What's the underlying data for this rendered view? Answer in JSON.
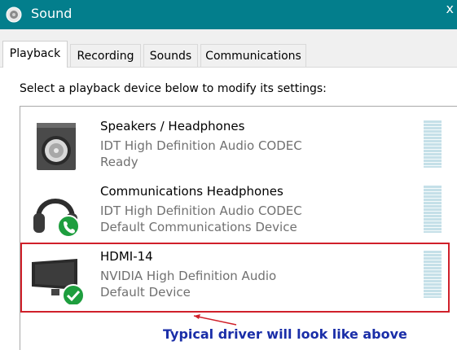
{
  "window": {
    "title": "Sound",
    "title_icon": "speaker-icon",
    "close_glyph": "x"
  },
  "tabs": [
    {
      "label": "Playback",
      "active": true
    },
    {
      "label": "Recording",
      "active": false
    },
    {
      "label": "Sounds",
      "active": false
    },
    {
      "label": "Communications",
      "active": false
    }
  ],
  "instruction": "Select a playback device below to modify its settings:",
  "devices": [
    {
      "name": "Speakers / Headphones",
      "driver": "IDT High Definition Audio CODEC",
      "status": "Ready",
      "icon": "speaker-box-icon",
      "badge": ""
    },
    {
      "name": "Communications Headphones",
      "driver": "IDT High Definition Audio CODEC",
      "status": "Default Communications Device",
      "icon": "headphones-icon",
      "badge": "phone-badge-icon"
    },
    {
      "name": "HDMI-14",
      "driver": "NVIDIA High Definition Audio",
      "status": "Default Device",
      "icon": "monitor-icon",
      "badge": "check-badge-icon"
    }
  ],
  "annotation": "Typical driver will look like above",
  "colors": {
    "titlebar": "#037e8c",
    "highlight": "#d0202a",
    "annotation": "#1a2ea8",
    "badge_green": "#1e9e3e"
  }
}
